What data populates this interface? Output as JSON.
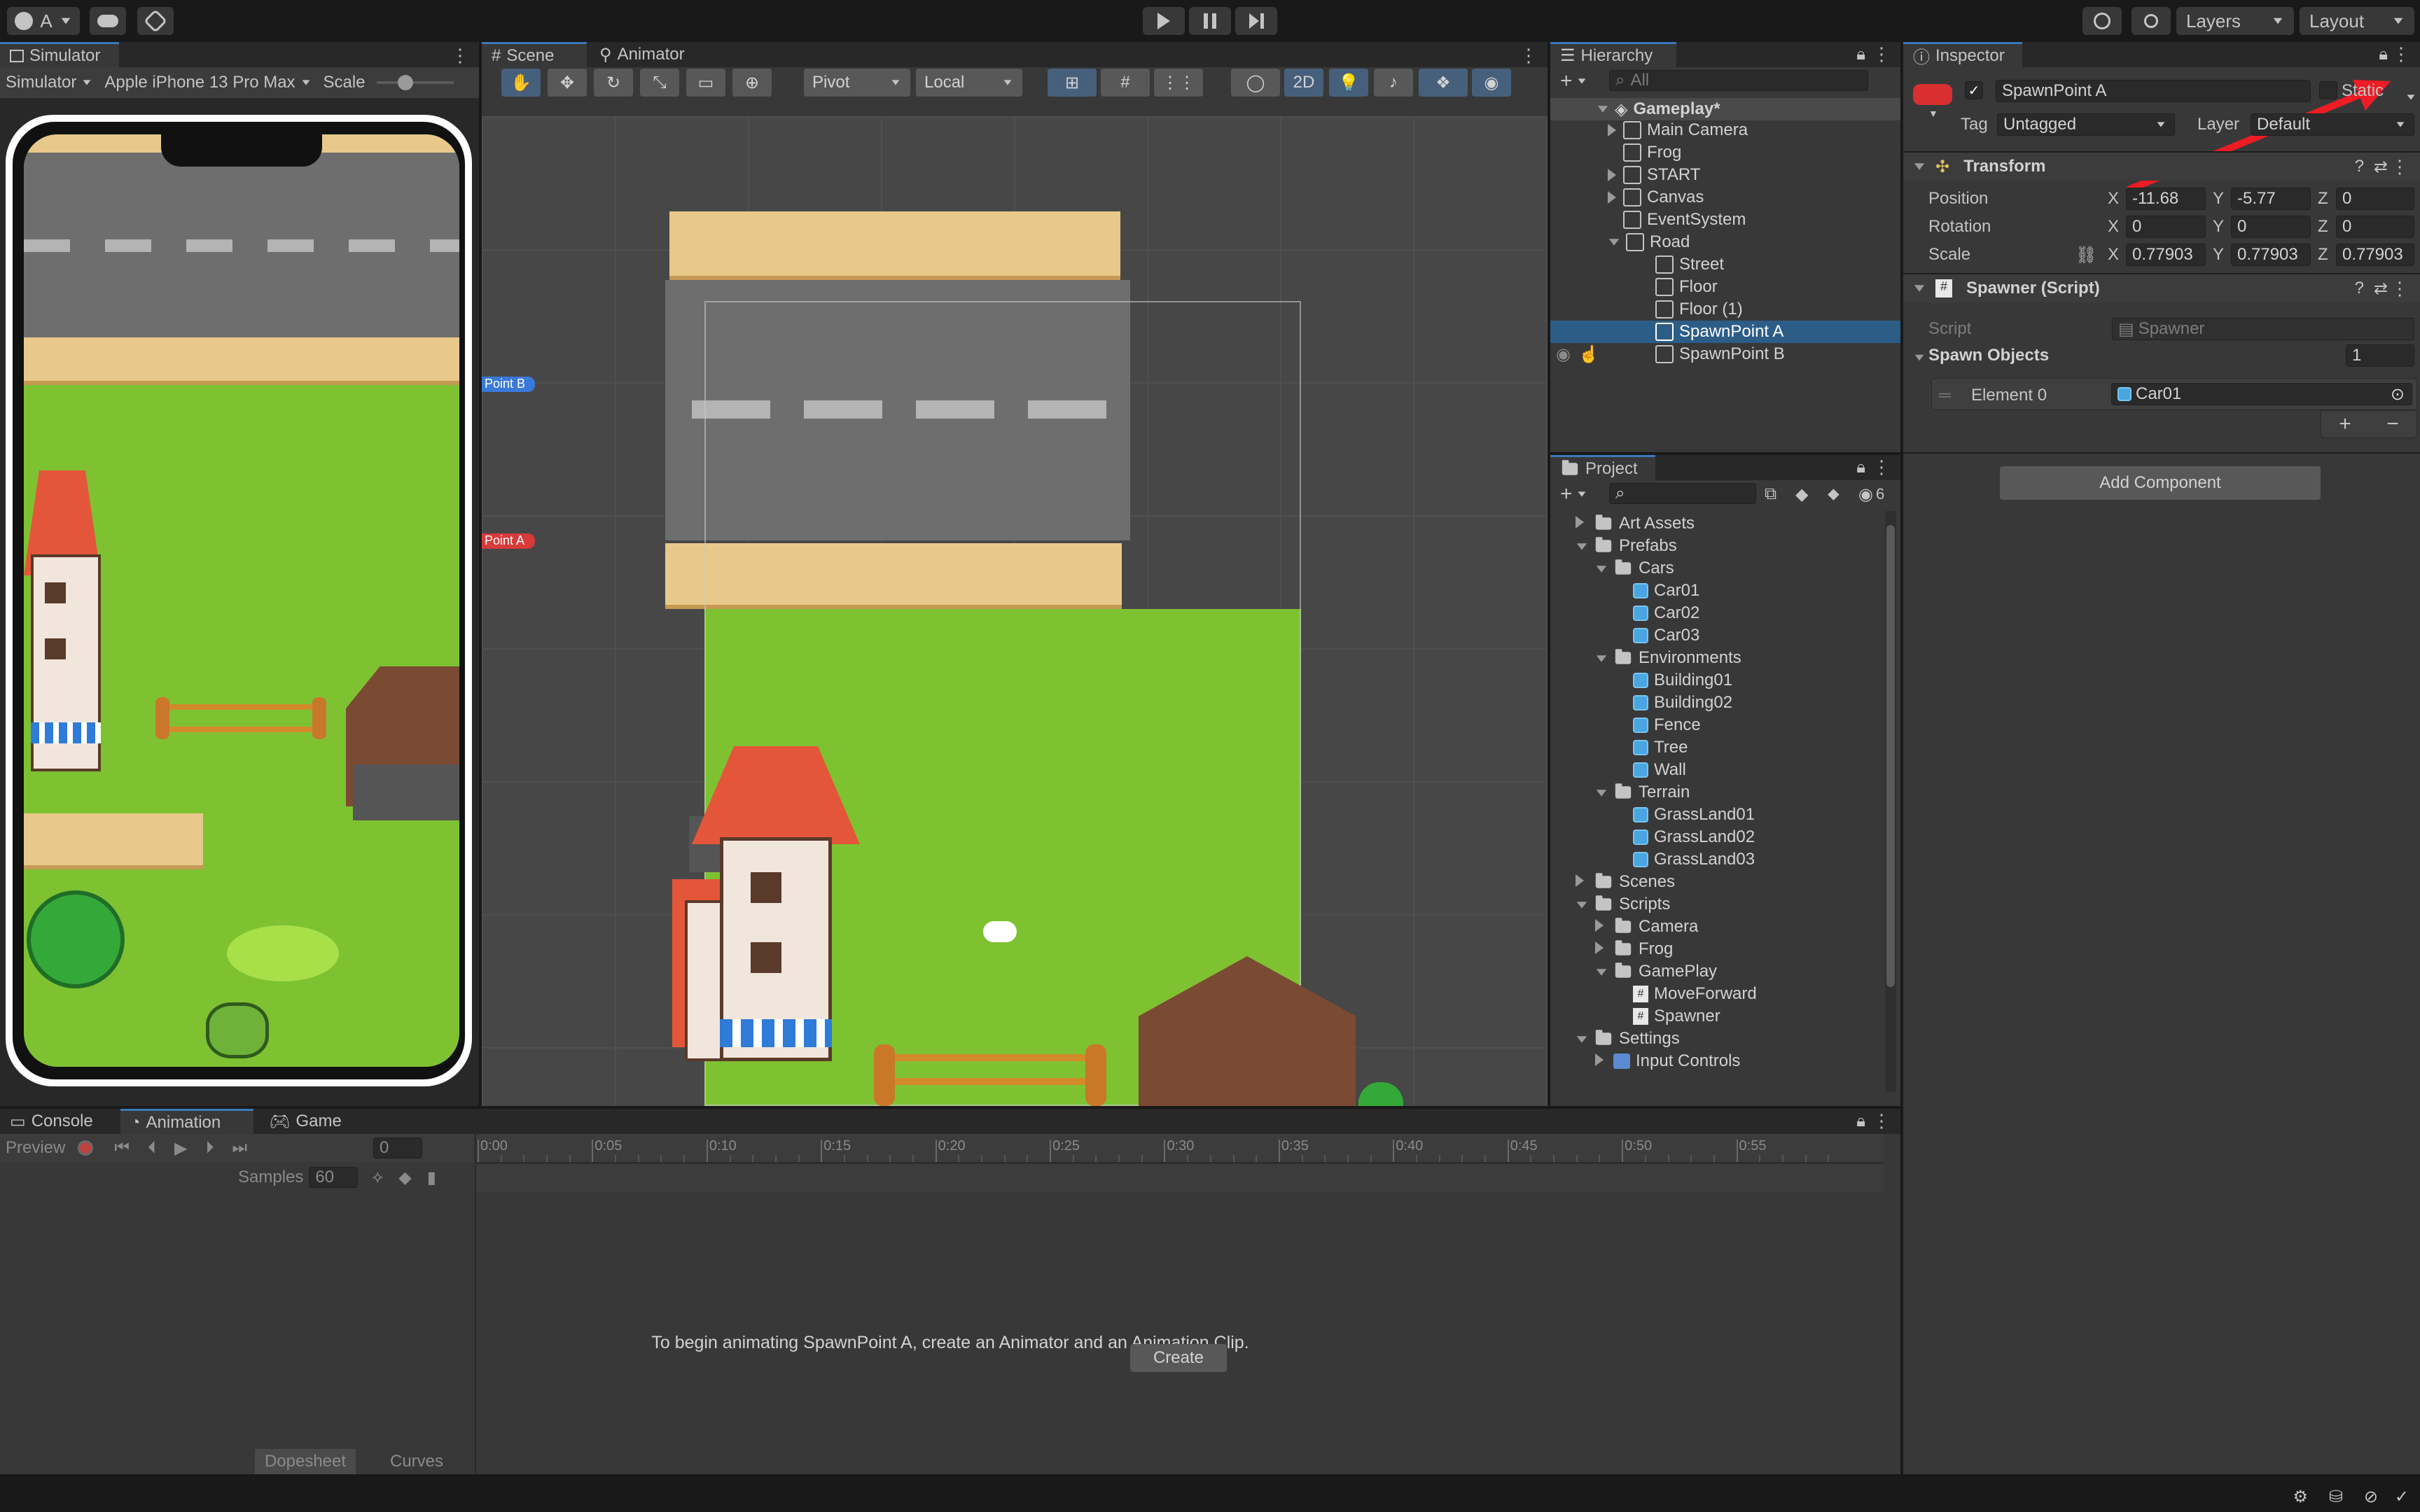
{
  "toolbar": {
    "account_label": "A",
    "layers_label": "Layers",
    "layout_label": "Layout"
  },
  "simulator": {
    "tab_label": "Simulator",
    "mode_label": "Simulator",
    "device_label": "Apple iPhone 13 Pro Max",
    "scale_label": "Scale"
  },
  "scene": {
    "tab_scene": "Scene",
    "tab_animator": "Animator",
    "pivot_label": "Pivot",
    "local_label": "Local",
    "twod_label": "2D",
    "point_b_label": "Point B",
    "point_a_label": "Point A"
  },
  "hierarchy": {
    "tab_label": "Hierarchy",
    "search_placeholder": "All",
    "root": "Gameplay*",
    "items": [
      "Main Camera",
      "Frog",
      "START",
      "Canvas",
      "EventSystem",
      "Road",
      "Street",
      "Floor",
      "Floor (1)",
      "SpawnPoint A",
      "SpawnPoint B"
    ]
  },
  "project": {
    "tab_label": "Project",
    "hidden_count": "6",
    "items": [
      "Art Assets",
      "Prefabs",
      "Cars",
      "Car01",
      "Car02",
      "Car03",
      "Environments",
      "Building01",
      "Building02",
      "Fence",
      "Tree",
      "Wall",
      "Terrain",
      "GrassLand01",
      "GrassLand02",
      "GrassLand03",
      "Scenes",
      "Scripts",
      "Camera",
      "Frog",
      "GamePlay",
      "MoveForward",
      "Spawner",
      "Settings",
      "Input Controls"
    ]
  },
  "inspector": {
    "tab_label": "Inspector",
    "object_name": "SpawnPoint A",
    "static_label": "Static",
    "tag_label": "Tag",
    "tag_value": "Untagged",
    "layer_label": "Layer",
    "layer_value": "Default",
    "transform": {
      "title": "Transform",
      "position_label": "Position",
      "rotation_label": "Rotation",
      "scale_label": "Scale",
      "position": {
        "x": "-11.68",
        "y": "-5.77",
        "z": "0"
      },
      "rotation": {
        "x": "0",
        "y": "0",
        "z": "0"
      },
      "scale": {
        "x": "0.77903",
        "y": "0.77903",
        "z": "0.77903"
      },
      "axis_x": "X",
      "axis_y": "Y",
      "axis_z": "Z"
    },
    "spawner": {
      "title": "Spawner (Script)",
      "script_label": "Script",
      "script_value": "Spawner",
      "spawn_objects_label": "Spawn Objects",
      "spawn_count": "1",
      "element_label": "Element 0",
      "element_value": "Car01"
    },
    "add_component_label": "Add Component"
  },
  "animation": {
    "tab_console": "Console",
    "tab_animation": "Animation",
    "tab_game": "Game",
    "preview_label": "Preview",
    "frame_value": "0",
    "samples_label": "Samples",
    "samples_value": "60",
    "timeline_ticks": [
      "0:00",
      "0:05",
      "0:10",
      "0:15",
      "0:20",
      "0:25",
      "0:30",
      "0:35",
      "0:40",
      "0:45",
      "0:50",
      "0:55"
    ],
    "message": "To begin animating SpawnPoint A, create an Animator and an Animation Clip.",
    "create_label": "Create",
    "dopesheet_label": "Dopesheet",
    "curves_label": "Curves"
  },
  "colors": {
    "accent": "#3a79bb",
    "selection": "#2c5d87",
    "grass": "#7ec232",
    "road": "#6e6e6e",
    "sidewalk": "#e8c98b"
  }
}
